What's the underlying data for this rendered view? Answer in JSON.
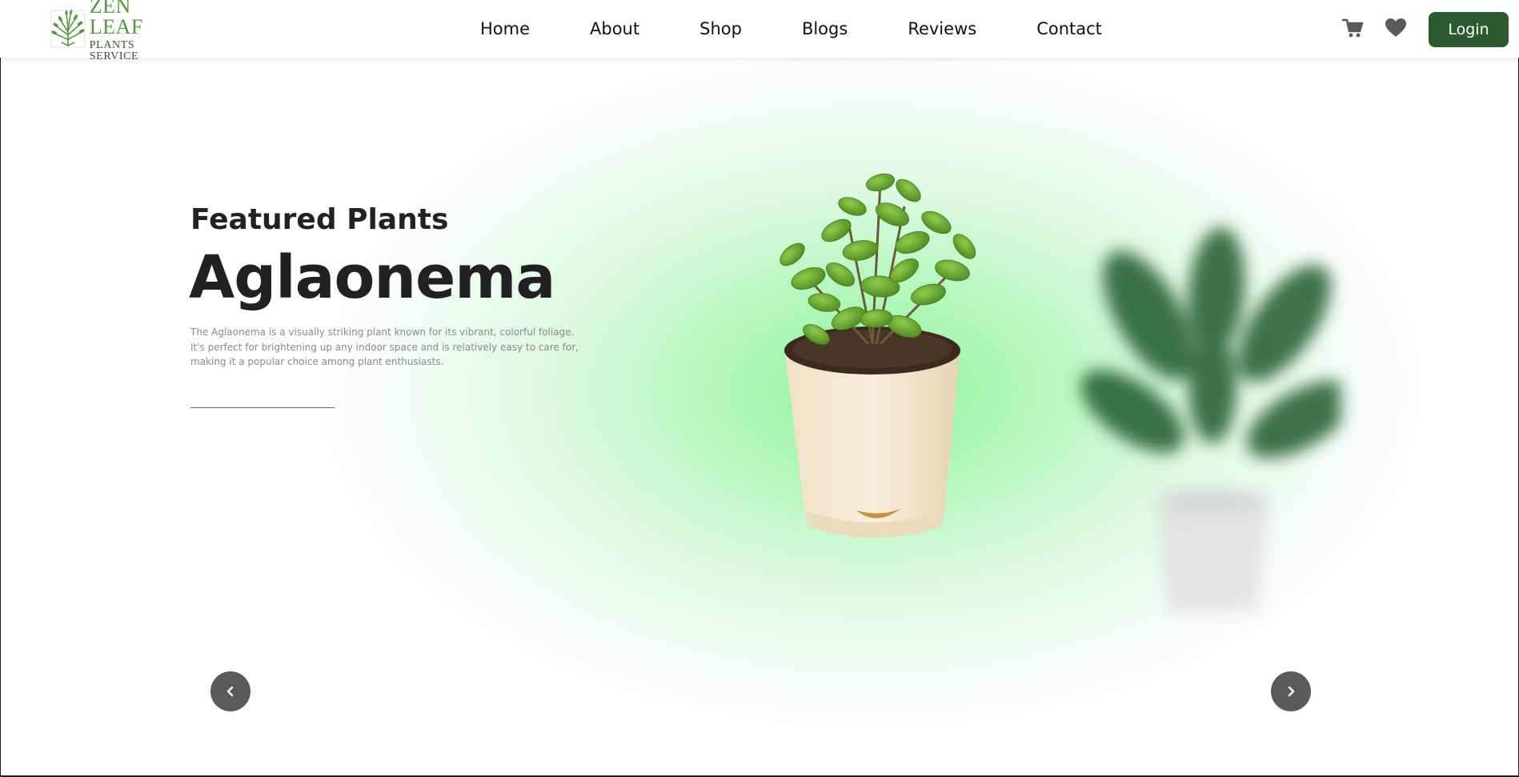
{
  "brand": {
    "title": "ZEN LEAF",
    "subtitle": "PLANTS SERVICE",
    "primary_color": "#2a5a2e",
    "logo_color": "#4f9a3a"
  },
  "nav": {
    "items": [
      {
        "label": "Home"
      },
      {
        "label": "About"
      },
      {
        "label": "Shop"
      },
      {
        "label": "Blogs"
      },
      {
        "label": "Reviews"
      },
      {
        "label": "Contact"
      }
    ],
    "cart_icon": "cart-icon",
    "wishlist_icon": "heart-icon",
    "login_label": "Login"
  },
  "hero": {
    "eyebrow": "Featured Plants",
    "plant_name": "Aglaonema",
    "description": "The Aglaonema is a visually striking plant known for its vibrant, colorful foliage. It's perfect for brightening up any indoor space and is relatively easy to care for, making it a popular choice among plant enthusiasts.",
    "glow_color": "#8ff59a",
    "prev_icon": "chevron-left-icon",
    "next_icon": "chevron-right-icon"
  }
}
